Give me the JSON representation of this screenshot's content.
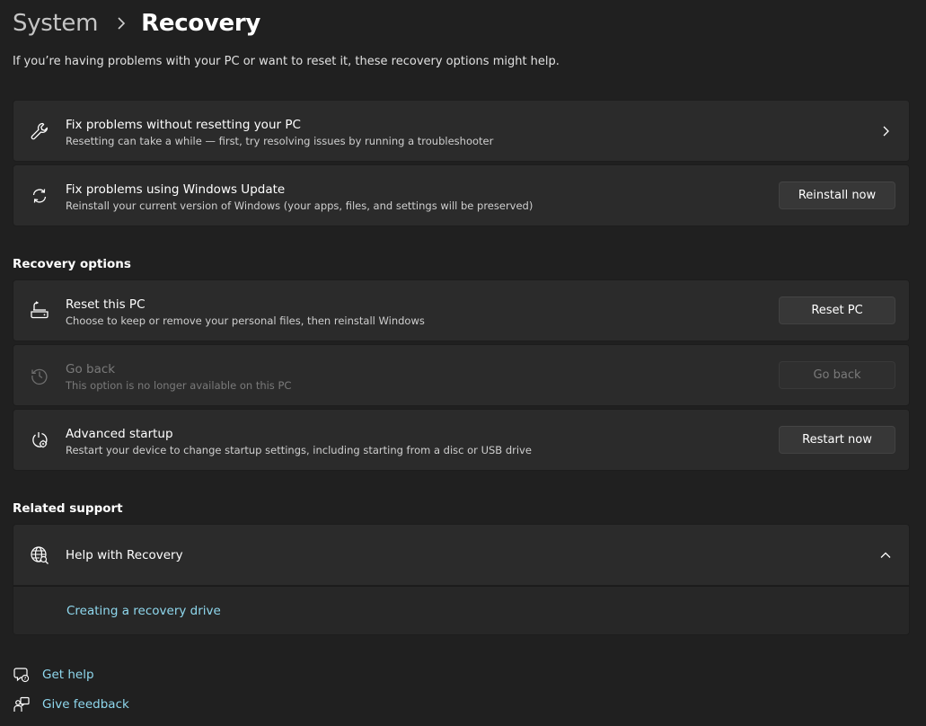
{
  "breadcrumb": {
    "parent": "System",
    "current": "Recovery"
  },
  "intro": "If you’re having problems with your PC or want to reset it, these recovery options might help.",
  "top_cards": {
    "fix_without_reset": {
      "title": "Fix problems without resetting your PC",
      "subtitle": "Resetting can take a while — first, try resolving issues by running a troubleshooter",
      "icon": "wrench-icon"
    },
    "windows_update": {
      "title": "Fix problems using Windows Update",
      "subtitle": "Reinstall your current version of Windows (your apps, files, and settings will be preserved)",
      "button": "Reinstall now",
      "icon": "sync-icon"
    }
  },
  "recovery_options": {
    "heading": "Recovery options",
    "reset": {
      "title": "Reset this PC",
      "subtitle": "Choose to keep or remove your personal files, then reinstall Windows",
      "button": "Reset PC",
      "icon": "reset-pc-icon"
    },
    "go_back": {
      "title": "Go back",
      "subtitle": "This option is no longer available on this PC",
      "button": "Go back",
      "icon": "history-icon",
      "disabled": true
    },
    "advanced_startup": {
      "title": "Advanced startup",
      "subtitle": "Restart your device to change startup settings, including starting from a disc or USB drive",
      "button": "Restart now",
      "icon": "power-gear-icon"
    }
  },
  "related_support": {
    "heading": "Related support",
    "help": {
      "title": "Help with Recovery",
      "icon": "globe-search-icon",
      "expanded": true,
      "links": [
        "Creating a recovery drive"
      ]
    }
  },
  "footer": {
    "get_help": "Get help",
    "give_feedback": "Give feedback"
  },
  "colors": {
    "background": "#202020",
    "card": "#2b2b2b",
    "link": "#8fd8ee",
    "disabled_text": "#7a7a7a"
  }
}
